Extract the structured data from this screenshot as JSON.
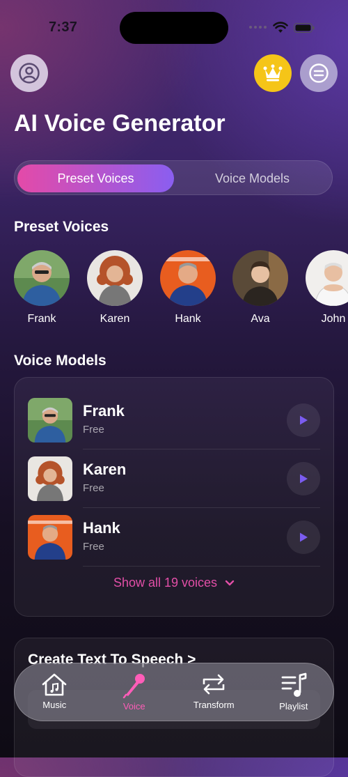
{
  "status_bar": {
    "time": "7:37"
  },
  "header": {
    "title": "AI Voice Generator"
  },
  "segments": {
    "active": "Preset Voices",
    "inactive": "Voice Models"
  },
  "preset_section": {
    "title": "Preset Voices",
    "voices": [
      "Frank",
      "Karen",
      "Hank",
      "Ava",
      "John"
    ]
  },
  "models_section": {
    "title": "Voice Models",
    "items": [
      {
        "name": "Frank",
        "tier": "Free"
      },
      {
        "name": "Karen",
        "tier": "Free"
      },
      {
        "name": "Hank",
        "tier": "Free"
      }
    ],
    "show_all": "Show all 19 voices"
  },
  "tts_section": {
    "title": "Create Text To Speech >"
  },
  "tabbar": {
    "tabs": [
      "Music",
      "Voice",
      "Transform",
      "Playlist"
    ],
    "active": "Voice"
  },
  "colors": {
    "accent_pink": "#e34fa8",
    "accent_purple": "#8a5ef0",
    "crown_gold": "#f5c518"
  }
}
